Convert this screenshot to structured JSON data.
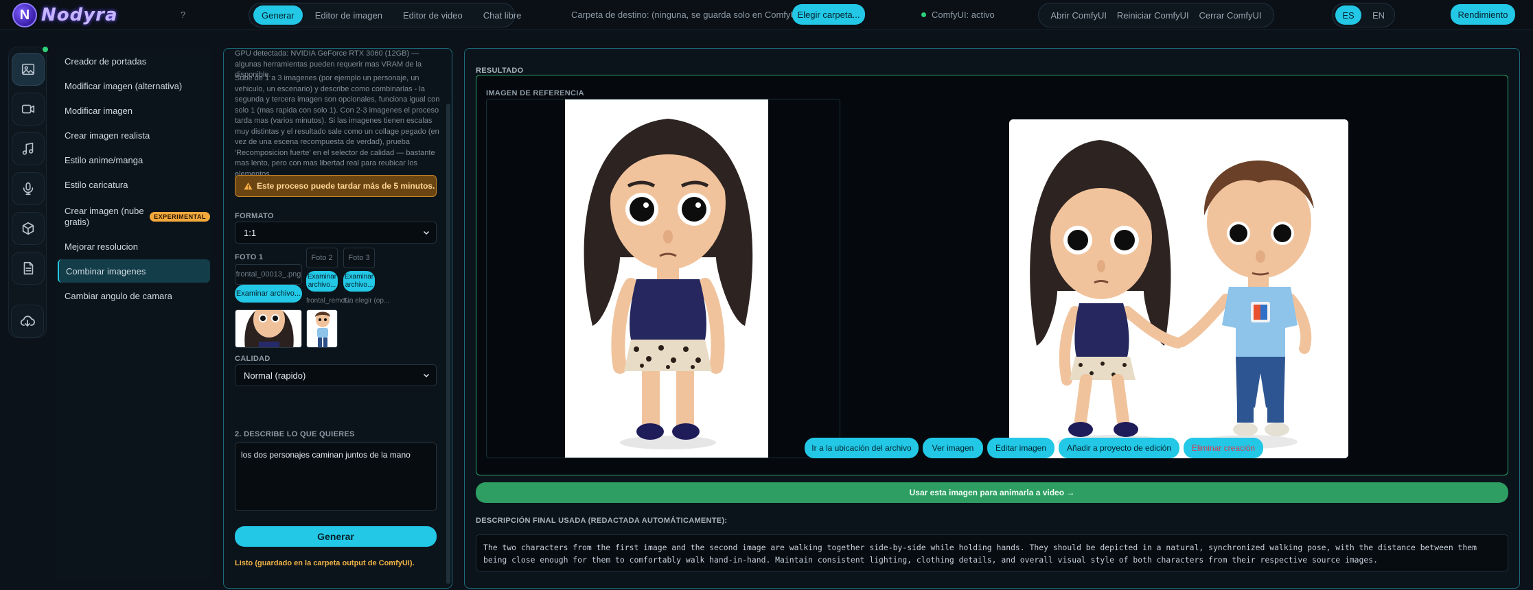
{
  "app": {
    "name": "Nodyra",
    "logo_letter": "N"
  },
  "header": {
    "help": "?",
    "mode_tabs": [
      {
        "label": "Generar",
        "active": true
      },
      {
        "label": "Editor de imagen",
        "active": false
      },
      {
        "label": "Editor de video",
        "active": false
      },
      {
        "label": "Chat libre",
        "active": false
      }
    ],
    "destination_label": "Carpeta de destino: (ninguna, se guarda solo en ComfyUI/output)",
    "choose_folder": "Elegir carpeta...",
    "status": "ComfyUI: activo",
    "comfy_buttons": [
      "Abrir ComfyUI",
      "Reiniciar ComfyUI",
      "Cerrar ComfyUI"
    ],
    "languages": [
      {
        "label": "ES",
        "active": true
      },
      {
        "label": "EN",
        "active": false
      }
    ],
    "performance": "Rendimiento"
  },
  "rail": {
    "items": [
      {
        "icon": "image-icon",
        "active": true
      },
      {
        "icon": "video-camera-icon",
        "active": false
      },
      {
        "icon": "music-note-icon",
        "active": false
      },
      {
        "icon": "microphone-icon",
        "active": false
      },
      {
        "icon": "cube-icon",
        "active": false
      },
      {
        "icon": "document-icon",
        "active": false
      }
    ],
    "bottom_icon": "cloud-download-icon"
  },
  "tools": [
    {
      "label": "Creador de portadas"
    },
    {
      "label": "Modificar imagen (alternativa)"
    },
    {
      "label": "Modificar imagen"
    },
    {
      "label": "Crear imagen realista"
    },
    {
      "label": "Estilo anime/manga"
    },
    {
      "label": "Estilo caricatura"
    },
    {
      "label": "Crear imagen (nube gratis)",
      "badge": "EXPERIMENTAL"
    },
    {
      "label": "Mejorar resolucion"
    },
    {
      "label": "Combinar imagenes",
      "active": true
    },
    {
      "label": "Cambiar angulo de camara"
    }
  ],
  "form": {
    "gpu_note": "GPU detectada: NVIDIA GeForce RTX 3060 (12GB) — algunas herramientas pueden requerir mas VRAM de la disponible.",
    "instructions": "Sube de 1 a 3 imagenes (por ejemplo un personaje, un vehiculo, un escenario) y describe como combinarlas - la segunda y tercera imagen son opcionales, funciona igual con solo 1 (mas rapida con solo 1). Con 2-3 imagenes el proceso tarda mas (varios minutos). Si las imagenes tienen escalas muy distintas y el resultado sale como un collage pegado (en vez de una escena recompuesta de verdad), prueba 'Recomposicion fuerte' en el selector de calidad — bastante mas lento, pero con mas libertad real para reubicar los elementos.",
    "warning": "Este proceso puede tardar más de 5 minutos.",
    "format_label": "FORMATO",
    "format_value": "1:1",
    "photo1_label": "FOTO 1",
    "photo1_file": "frontal_00013_.png",
    "photo2_label": "Foto 2",
    "photo3_label": "Foto 3",
    "browse_main": "Examinar archivo...",
    "browse_small": "Examinar archivo...",
    "photo2_file": "frontal_remot...",
    "photo3_file": "Sin elegir (op...",
    "quality_label": "CALIDAD",
    "quality_value": "Normal (rapido)",
    "describe_label": "2. DESCRIBE LO QUE QUIERES",
    "prompt": "los dos personajes caminan juntos de la mano",
    "generate": "Generar",
    "ready_msg": "Listo (guardado en la carpeta output de ComfyUI)."
  },
  "result": {
    "label": "RESULTADO",
    "reference_label": "IMAGEN DE REFERENCIA",
    "actions": [
      "Ir a la ubicación del archivo",
      "Ver imagen",
      "Editar imagen",
      "Añadir a proyecto de edición",
      "Eliminar creación"
    ],
    "animate": "Usar esta imagen para animarla a video →",
    "final_label": "DESCRIPCIÓN FINAL USADA (REDACTADA AUTOMÁTICAMENTE):",
    "final_text": "The two characters from the first image and the second image are walking together side-by-side while holding hands. They should be depicted in a natural, synchronized walking pose, with the distance between them being close enough for them to comfortably walk hand-in-hand. Maintain consistent lighting, clothing details, and overall visual style of both characters from their respective source images."
  },
  "colors": {
    "accent": "#22c8e6",
    "panel_border": "#1c6b7a",
    "success": "#2e9e63",
    "warning": "#c7862a",
    "danger": "#d6394e"
  }
}
